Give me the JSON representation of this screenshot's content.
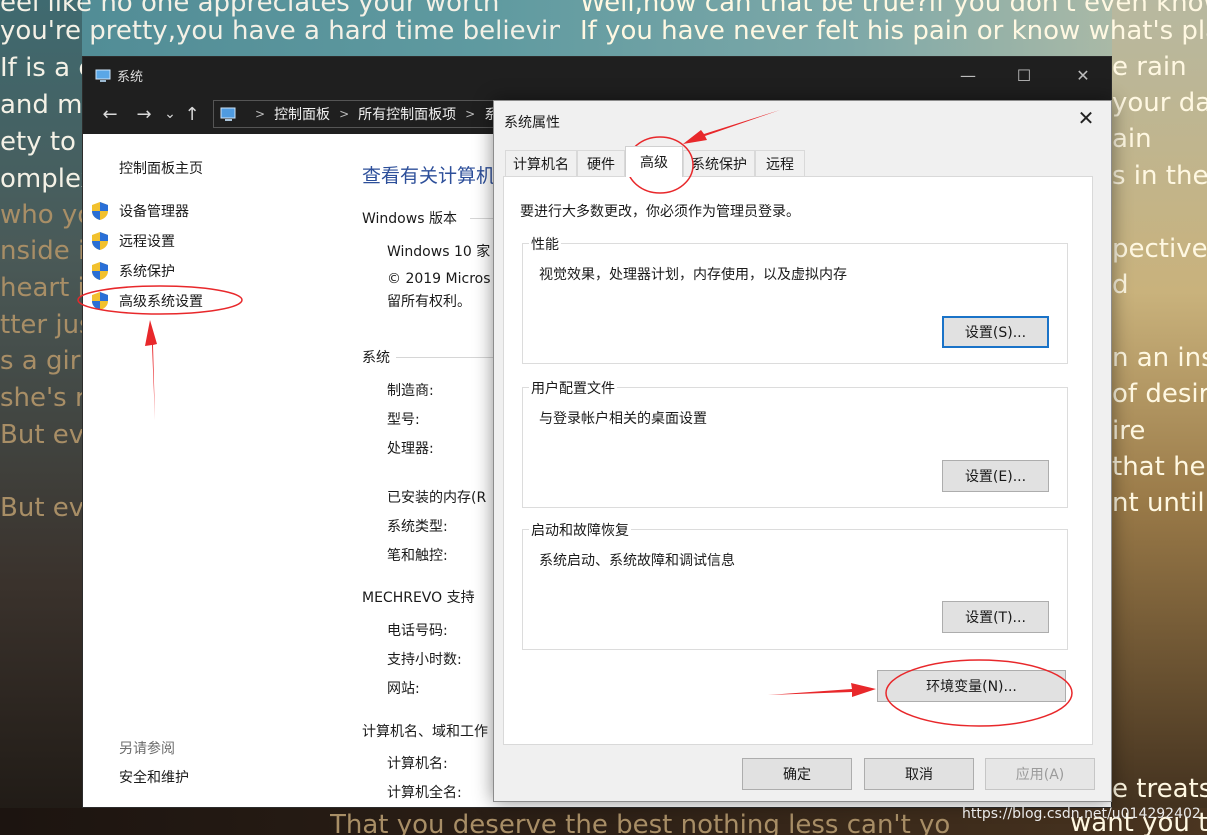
{
  "background": {
    "lyrics": [
      "eel like no one appreciates your worth",
      "you're pretty,you have a hard time believing",
      "If is a c",
      "and mo",
      "ety to a",
      "omplex",
      "who you",
      "nside in",
      "heart i",
      "tter jus",
      "s a girl y",
      "she's r",
      "But eve",
      "But ev",
      "That you deserve the best nothing less can't you see",
      "Well,how can that be true?if you don't even know his",
      "If you have never felt his pain or know what's playing",
      "e rain",
      "your day",
      "ain",
      "s in the",
      "pective",
      "d",
      "n an inst",
      "of desire",
      "ire",
      "that he's",
      "nt until y",
      "e treats",
      "want you to b"
    ],
    "watermark": "https://blog.csdn.net/u014292402"
  },
  "system_window": {
    "title": "系统",
    "app_icon": "computer-icon",
    "controls": {
      "minimize": "—",
      "maximize": "☐",
      "close": "✕"
    },
    "address_bar": {
      "back": "←",
      "forward": "→",
      "recent": "⌄",
      "up": "↑",
      "location_icon": "control-panel-icon",
      "breadcrumb": [
        "控制面板",
        "所有控制面板项",
        "系"
      ]
    },
    "left_pane": {
      "home": "控制面板主页",
      "items": [
        {
          "label": "设备管理器",
          "icon": "shield-icon"
        },
        {
          "label": "远程设置",
          "icon": "shield-icon"
        },
        {
          "label": "系统保护",
          "icon": "shield-icon"
        },
        {
          "label": "高级系统设置",
          "icon": "shield-icon"
        }
      ],
      "see_also": "另请参阅",
      "security_link": "安全和维护"
    },
    "main": {
      "title": "查看有关计算机",
      "windows_edition": {
        "heading": "Windows 版本",
        "edition": "Windows 10 家",
        "copyright_line1": "© 2019 Micros",
        "copyright_line2": "留所有权利。"
      },
      "system": {
        "heading": "系统",
        "rows": [
          "制造商:",
          "型号:",
          "处理器:",
          "已安装的内存(R",
          "系统类型:",
          "笔和触控:"
        ]
      },
      "support": {
        "heading": "MECHREVO 支持",
        "rows": [
          "电话号码:",
          "支持小时数:",
          "网站:"
        ]
      },
      "computer_name": {
        "heading": "计算机名、域和工作",
        "rows": [
          "计算机名:",
          "计算机全名:"
        ]
      }
    }
  },
  "dialog": {
    "title": "系统属性",
    "close": "✕",
    "tabs": [
      "计算机名",
      "硬件",
      "高级",
      "系统保护",
      "远程"
    ],
    "active_tab": "高级",
    "admin_note": "要进行大多数更改，你必须作为管理员登录。",
    "performance": {
      "label": "性能",
      "description": "视觉效果，处理器计划，内存使用，以及虚拟内存",
      "button": "设置(S)..."
    },
    "user_profiles": {
      "label": "用户配置文件",
      "description": "与登录帐户相关的桌面设置",
      "button": "设置(E)..."
    },
    "startup_recovery": {
      "label": "启动和故障恢复",
      "description": "系统启动、系统故障和调试信息",
      "button": "设置(T)..."
    },
    "env_button": "环境变量(N)...",
    "ok": "确定",
    "cancel": "取消",
    "apply": "应用(A)"
  },
  "annotation_color": "#e8282b"
}
